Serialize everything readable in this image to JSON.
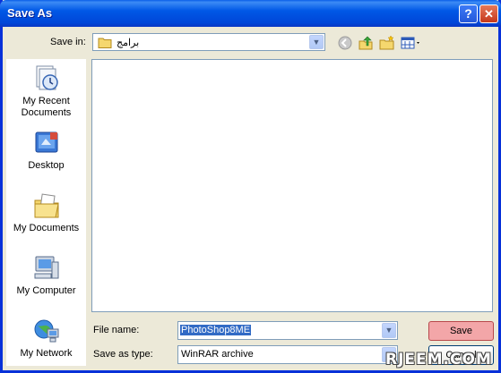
{
  "window": {
    "title": "Save As"
  },
  "titlebar": {
    "help_label": "?",
    "close_label": "✕"
  },
  "save_in": {
    "label": "Save in:",
    "value": "برامج"
  },
  "places": [
    {
      "line1": "My Recent",
      "line2": "Documents",
      "icon": "recent-documents-icon"
    },
    {
      "line1": "Desktop",
      "line2": "",
      "icon": "desktop-icon"
    },
    {
      "line1": "My Documents",
      "line2": "",
      "icon": "my-documents-icon"
    },
    {
      "line1": "My Computer",
      "line2": "",
      "icon": "my-computer-icon"
    },
    {
      "line1": "My Network",
      "line2": "",
      "icon": "my-network-icon"
    }
  ],
  "file_name": {
    "label": "File name:",
    "value": "PhotoShop8ME"
  },
  "save_as_type": {
    "label": "Save as type:",
    "value": "WinRAR archive"
  },
  "buttons": {
    "save": "Save",
    "cancel": "Cancel"
  },
  "watermark": "RJEEM.COM",
  "colors": {
    "title_blue": "#0054E3",
    "save_button": "#F3A6A8",
    "selection": "#316AC5"
  }
}
